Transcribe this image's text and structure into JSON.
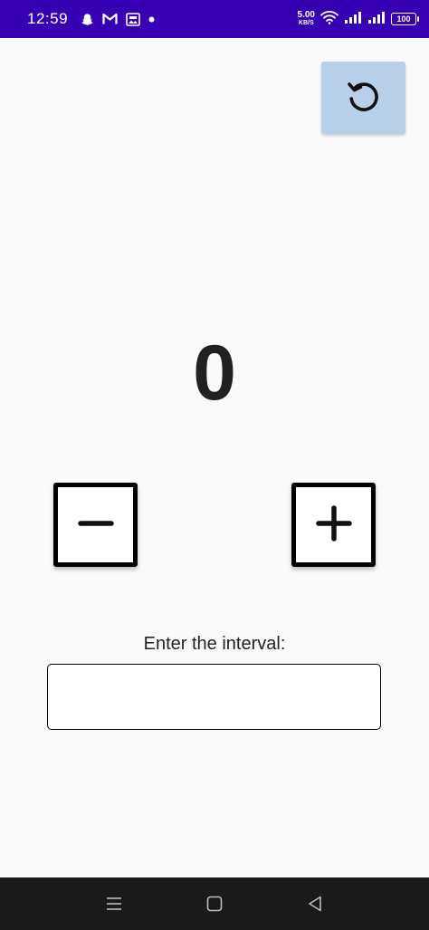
{
  "status_bar": {
    "time": "12:59",
    "net_speed_value": "5.00",
    "net_speed_unit": "KB/S",
    "battery": "100",
    "icons": [
      "snapchat-icon",
      "gmail-icon",
      "gallery-icon",
      "dot-icon",
      "wifi-icon",
      "signal-icon",
      "signal-icon",
      "battery-icon"
    ]
  },
  "counter": {
    "value": "0"
  },
  "buttons": {
    "reset_icon": "refresh-icon",
    "decrement_icon": "minus-icon",
    "increment_icon": "plus-icon"
  },
  "interval": {
    "label": "Enter the interval:",
    "value": "",
    "placeholder": ""
  },
  "nav_bar": {
    "icons": [
      "menu-icon",
      "home-icon",
      "back-icon"
    ]
  },
  "colors": {
    "status_bar": "#3700b3",
    "reset_button": "#b8cfe8",
    "background": "#fafafa",
    "nav_bar": "#1a1a1a"
  }
}
